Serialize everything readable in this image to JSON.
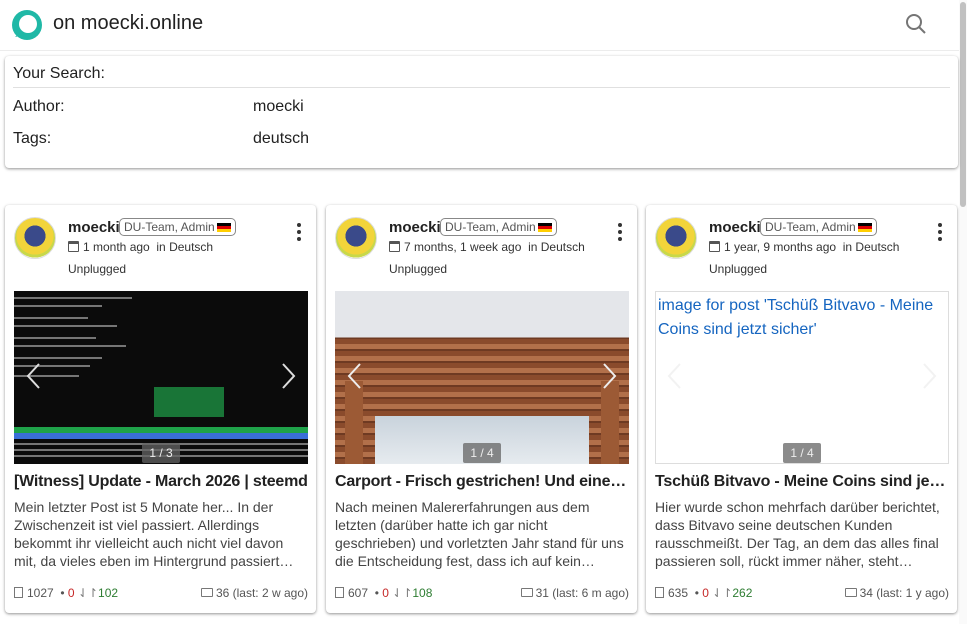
{
  "header": {
    "site_title": "on moecki.online",
    "brand_color": "#1fb8a6",
    "search_icon": "search-icon"
  },
  "search": {
    "title": "Your Search:",
    "author_label": "Author:",
    "author_value": "moecki",
    "tags_label": "Tags:",
    "tags_value": "deutsch"
  },
  "posts": [
    {
      "author": "moecki",
      "badge": "DU-Team, Admin",
      "age": "1 month ago",
      "community": "in Deutsch",
      "tag": "Unplugged",
      "image_counter": "1 / 3",
      "title": "[Witness] Update - March 2026 | steemd",
      "excerpt": "Mein letzter Post ist 5 Monate her... In der Zwischenzeit ist viel passiert. Allerdings bekommt ihr vielleicht auch nicht viel davon mit, da vieles eben im Hintergrund passiert…",
      "words": "1027",
      "downvotes": "0",
      "upvotes": "102",
      "comments": "36 (last: 2 w ago)"
    },
    {
      "author": "moecki",
      "badge": "DU-Team, Admin",
      "age": "7 months, 1 week ago",
      "community": "in Deutsch",
      "tag": "Unplugged",
      "image_counter": "1 / 4",
      "title": "Carport - Frisch gestrichen! Und eine…",
      "excerpt": "Nach meinen Malererfahrungen aus dem letzten (darüber hatte ich gar nicht geschrieben) und vorletzten Jahr stand für uns die Entscheidung fest, dass ich auf kein…",
      "words": "607",
      "downvotes": "0",
      "upvotes": "108",
      "comments": "31 (last: 6 m ago)"
    },
    {
      "author": "moecki",
      "badge": "DU-Team, Admin",
      "age": "1 year, 9 months ago",
      "community": "in Deutsch",
      "tag": "Unplugged",
      "image_counter": "1 / 4",
      "image_alt": "image for post 'Tschüß Bitvavo - Meine Coins sind jetzt sicher'",
      "title": "Tschüß Bitvavo - Meine Coins sind jetzt…",
      "excerpt": "Hier wurde schon mehrfach darüber berichtet, dass Bitvavo seine deutschen Kunden rausschmeißt. Der Tag, an dem das alles final passieren soll, rückt immer näher, steht…",
      "words": "635",
      "downvotes": "0",
      "upvotes": "262",
      "comments": "34 (last: 1 y ago)"
    }
  ]
}
